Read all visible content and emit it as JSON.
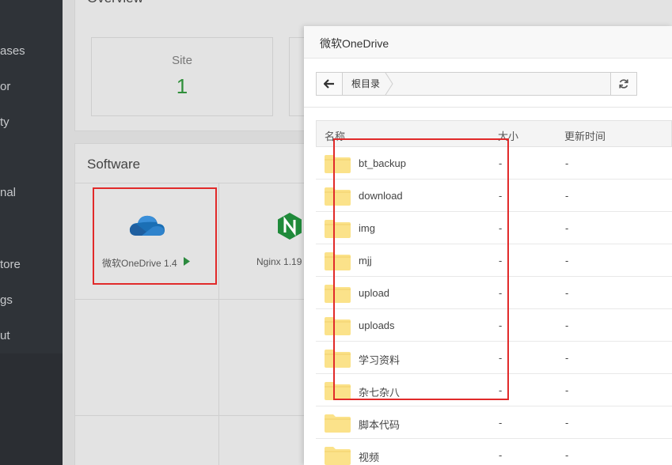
{
  "sidebar": {
    "items": [
      {
        "label": "ases"
      },
      {
        "label": "or"
      },
      {
        "label": "ty"
      },
      {
        "label": "nal"
      },
      {
        "label": "tore"
      },
      {
        "label": "gs"
      },
      {
        "label": "ut"
      }
    ]
  },
  "overview": {
    "title": "Overview",
    "stats": [
      {
        "label": "Site",
        "value": "1"
      }
    ]
  },
  "software": {
    "title": "Software",
    "items": [
      {
        "label": "微软OneDrive 1.4",
        "icon": "onedrive-cloud-icon"
      },
      {
        "label": "Nginx 1.19",
        "icon": "nginx-icon"
      }
    ]
  },
  "modal": {
    "title": "微软OneDrive",
    "breadcrumb": "根目录",
    "columns": {
      "name": "名称",
      "size": "大小",
      "time": "更新时间"
    },
    "rows": [
      {
        "name": "bt_backup",
        "size": "-",
        "time": "-"
      },
      {
        "name": "download",
        "size": "-",
        "time": "-"
      },
      {
        "name": "img",
        "size": "-",
        "time": "-"
      },
      {
        "name": "mjj",
        "size": "-",
        "time": "-"
      },
      {
        "name": "upload",
        "size": "-",
        "time": "-"
      },
      {
        "name": "uploads",
        "size": "-",
        "time": "-"
      },
      {
        "name": "学习资料",
        "size": "-",
        "time": "-"
      },
      {
        "name": "杂七杂八",
        "size": "-",
        "time": "-"
      },
      {
        "name": "脚本代码",
        "size": "-",
        "time": "-"
      },
      {
        "name": "视频",
        "size": "-",
        "time": "-"
      }
    ]
  },
  "colors": {
    "highlight": "#e12a2a",
    "folder": "#fbe28a",
    "stat_value": "#2f8f3a",
    "sidebar": "#2f3338"
  }
}
